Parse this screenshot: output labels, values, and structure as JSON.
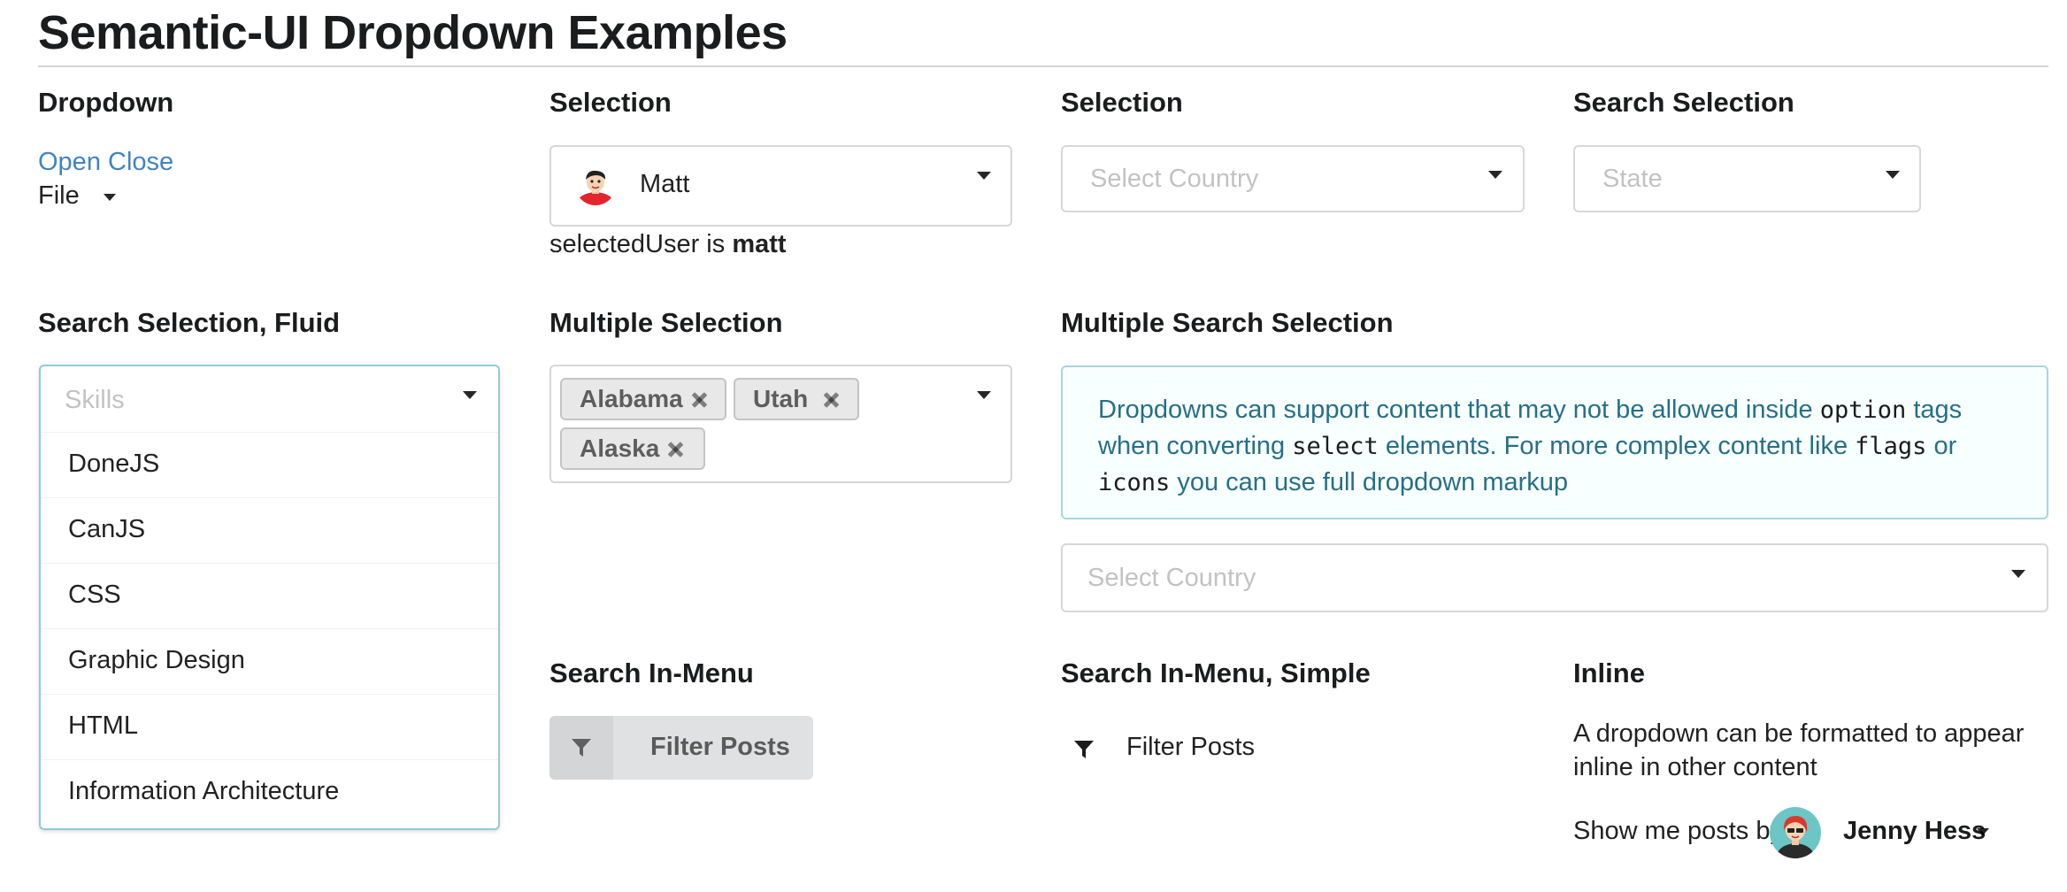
{
  "page": {
    "title": "Semantic-UI Dropdown Examples"
  },
  "sections": {
    "dropdown": {
      "header": "Dropdown",
      "open_close_link": "Open Close",
      "file_label": "File"
    },
    "selection_user": {
      "header": "Selection",
      "value": "Matt",
      "selected_prefix": "selectedUser is",
      "selected_value": "matt"
    },
    "selection_country": {
      "header": "Selection",
      "placeholder": "Select Country"
    },
    "search_selection": {
      "header": "Search Selection",
      "placeholder": "State"
    },
    "search_selection_fluid": {
      "header": "Search Selection, Fluid",
      "placeholder": "Skills",
      "items": [
        "DoneJS",
        "CanJS",
        "CSS",
        "Graphic Design",
        "HTML",
        "Information Architecture"
      ]
    },
    "multiple_selection": {
      "header": "Multiple Selection",
      "labels": [
        "Alabama",
        "Utah",
        "Alaska"
      ]
    },
    "multiple_search_selection": {
      "header": "Multiple Search Selection",
      "message": {
        "part1": "Dropdowns can support content that may not be allowed inside ",
        "code1": "option",
        "part2": " tags when converting ",
        "code2": "select",
        "part3": " elements. For more complex content like ",
        "code3": "flags",
        "part4": " or ",
        "code4": "icons",
        "part5": " you can use full dropdown markup"
      },
      "placeholder": "Select Country"
    },
    "search_in_menu": {
      "header": "Search In-Menu",
      "button_label": "Filter Posts",
      "icon": "filter-icon"
    },
    "search_in_menu_simple": {
      "header": "Search In-Menu, Simple",
      "button_label": "Filter Posts",
      "icon": "filter-icon"
    },
    "inline": {
      "header": "Inline",
      "description": "A dropdown can be formatted to appear inline in other content",
      "show_prefix": "Show me posts by",
      "user": "Jenny Hess"
    }
  },
  "colors": {
    "link": "#4183c4",
    "message_bg": "#f8ffff",
    "message_border": "#a9d5de",
    "message_text": "#276f86",
    "active_border": "#96c8da"
  }
}
